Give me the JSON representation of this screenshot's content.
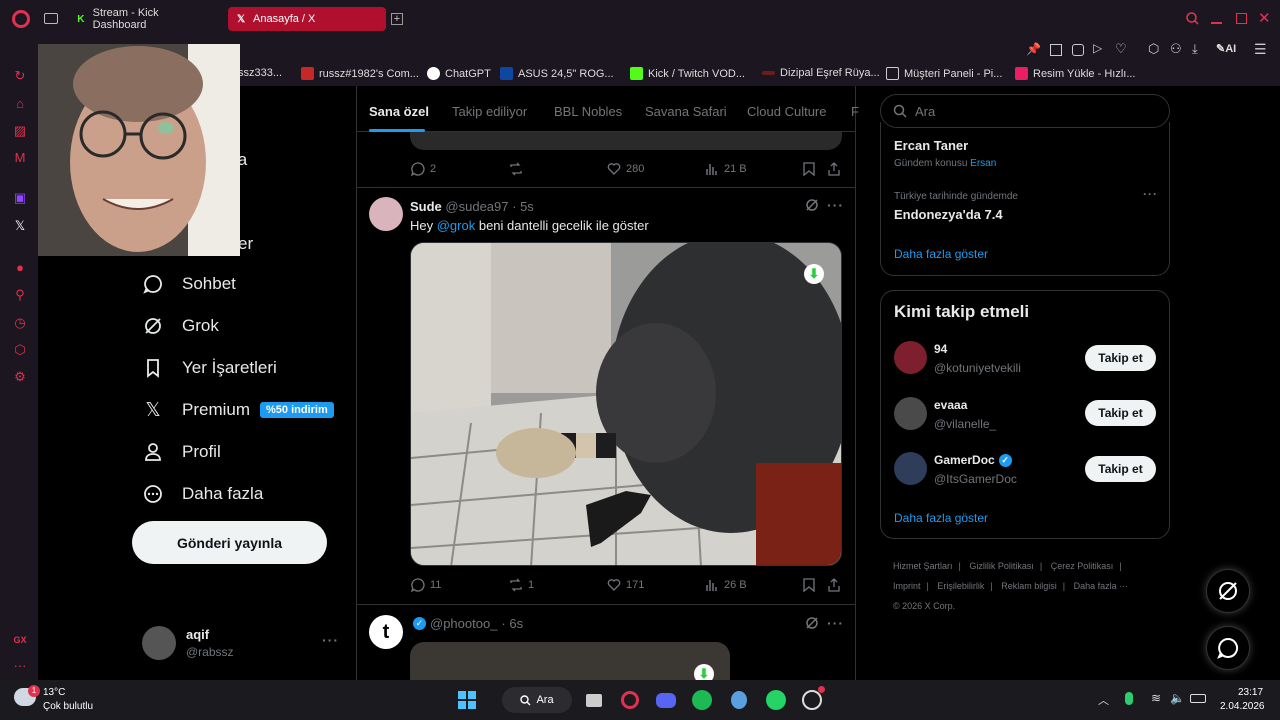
{
  "browser": {
    "tabs": [
      {
        "label": "Stream - Kick Dashboard"
      },
      {
        "label": "Anasayfa / X"
      }
    ],
    "bookmarks": [
      {
        "label": "ssz333..."
      },
      {
        "label": "russz#1982's Com..."
      },
      {
        "label": "ChatGPT"
      },
      {
        "label": "ASUS 24,5\" ROG..."
      },
      {
        "label": "Kick / Twitch VOD..."
      },
      {
        "label": "Dizipal Eşref Rüya..."
      },
      {
        "label": "Müşteri Paneli - Pi..."
      },
      {
        "label": "Resim Yükle - Hızlı..."
      }
    ],
    "ai_label": "AI"
  },
  "nav": {
    "partial_top": "fa",
    "partial_mid": "er",
    "items": [
      {
        "label": "Sohbet",
        "icon": "chat-bubble-icon"
      },
      {
        "label": "Grok",
        "icon": "grok-icon"
      },
      {
        "label": "Yer İşaretleri",
        "icon": "bookmark-icon"
      },
      {
        "label": "Premium",
        "icon": "x-logo-icon",
        "badge": "%50 indirim"
      },
      {
        "label": "Profil",
        "icon": "person-icon"
      },
      {
        "label": "Daha fazla",
        "icon": "more-circle-icon"
      }
    ],
    "post_button": "Gönderi yayınla",
    "account": {
      "name": "aqif",
      "handle": "@rabssz"
    }
  },
  "feed": {
    "tabs": [
      "Sana özel",
      "Takip ediliyor",
      "BBL Nobles",
      "Savana Safari",
      "Cloud Culture",
      "F"
    ],
    "prev_actions": {
      "replies": "2",
      "retweets": "",
      "likes": "280",
      "views": "21 B"
    },
    "tweet": {
      "name": "Sude",
      "handle": "@sudea97",
      "time": "· 5s",
      "mention": "@grok",
      "text": " beni dantelli gecelik ile göster",
      "greeting": "Hey ",
      "replies": "11",
      "retweets": "1",
      "likes": "171",
      "views": "26 B"
    },
    "next_tweet": {
      "handle": "@phootoo_",
      "time": "· 6s"
    }
  },
  "right": {
    "search_placeholder": "Ara",
    "trends": [
      {
        "title": "Ercan Taner",
        "meta": "Gündem konusu",
        "meta_link": "Ersan"
      },
      {
        "meta": "Türkiye tarihinde gündemde",
        "title": "Endonezya'da 7.4"
      }
    ],
    "trends_more": "Daha fazla göster",
    "who_to_follow": {
      "title": "Kimi takip etmeli",
      "users": [
        {
          "name": "94",
          "handle": "@kotuniyetvekili",
          "button": "Takip et",
          "verified": false
        },
        {
          "name": "evaaa",
          "handle": "@vilanelle_",
          "button": "Takip et",
          "verified": false
        },
        {
          "name": "GamerDoc",
          "handle": "@ItsGamerDoc",
          "button": "Takip et",
          "verified": true
        }
      ],
      "more": "Daha fazla göster"
    },
    "footer": [
      "Hizmet Şartları",
      "|",
      "Gizlilik Politikası",
      "|",
      "Çerez Politikası",
      "|",
      "Imprint",
      "|",
      "Erişilebilirlik",
      "|",
      "Reklam bilgisi",
      "|",
      "Daha fazla ···",
      "© 2026 X Corp."
    ]
  },
  "taskbar": {
    "weather_temp": "13°C",
    "weather_desc": "Çok bulutlu",
    "search_label": "Ara",
    "time": "23:17",
    "date": "2.04.2026"
  },
  "colors": {
    "accent": "#1d9bf0",
    "opera_red": "#e0324f",
    "tab_active": "#b0102e"
  }
}
